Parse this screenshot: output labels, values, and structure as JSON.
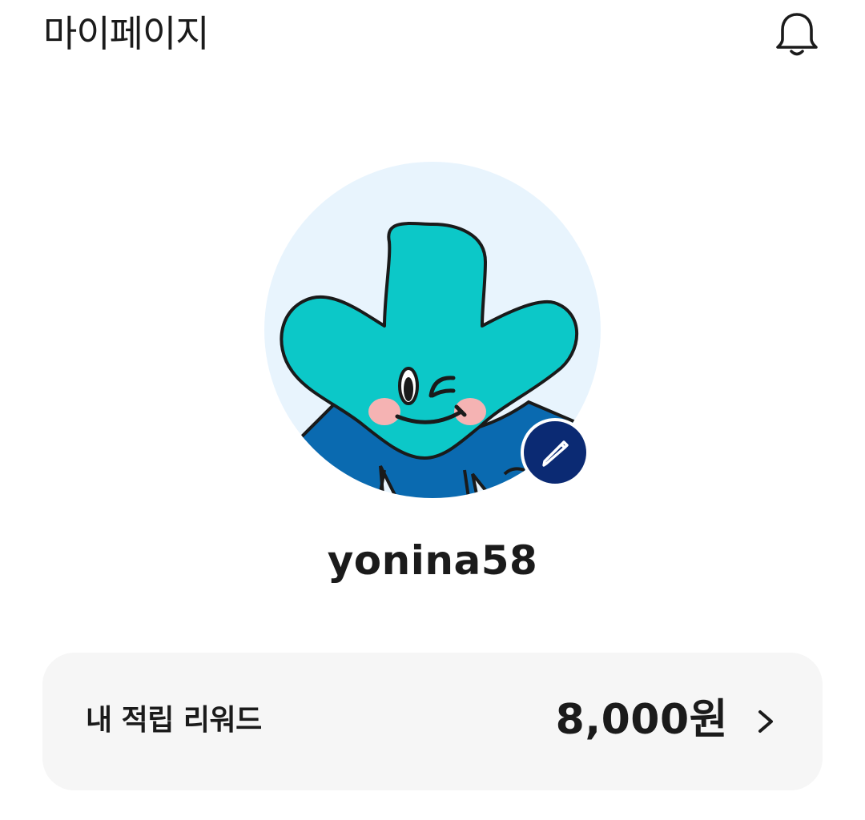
{
  "header": {
    "title": "마이페이지",
    "notification_icon": "bell-icon"
  },
  "profile": {
    "avatar_icon": "mascot-avatar",
    "edit_icon": "pencil-icon",
    "username": "yonina58"
  },
  "reward": {
    "label": "내 적립 리워드",
    "amount": "8,000원",
    "chevron_icon": "chevron-right-icon"
  },
  "colors": {
    "avatar_bg": "#e8f4fd",
    "mascot_teal": "#0cc8c8",
    "mascot_shirt": "#0a6ab0",
    "edit_button": "#0b2a73",
    "card_bg": "#f6f6f6"
  }
}
